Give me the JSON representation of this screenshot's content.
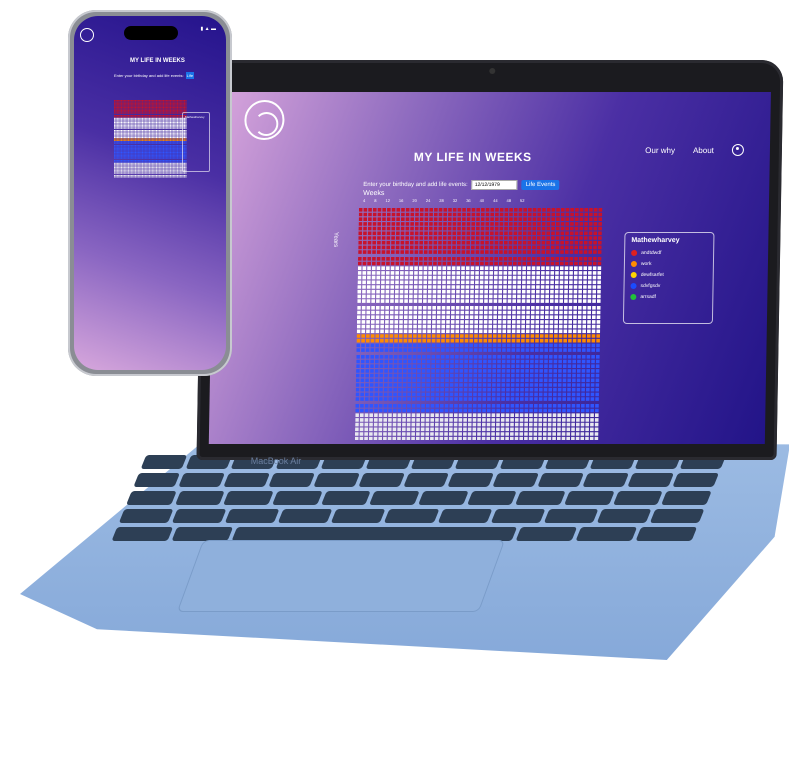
{
  "site": {
    "title": "MY LIFE IN WEEKS",
    "nav": [
      "Our why",
      "About"
    ],
    "birthday_prompt": "Enter your birthday and add life events:",
    "birthday_value": "12/12/1979",
    "life_events_button": "Life Events",
    "weeks_label": "Weeks",
    "years_label": "Years",
    "week_ticks": [
      "4",
      "8",
      "12",
      "16",
      "20",
      "24",
      "28",
      "32",
      "36",
      "40",
      "44",
      "48",
      "52"
    ],
    "legend": {
      "title": "Mathewharvey",
      "items": [
        {
          "label": "andtdwdf",
          "color": "#e02020"
        },
        {
          "label": "work",
          "color": "#ff8c00"
        },
        {
          "label": "dewfsarfet",
          "color": "#ffd400"
        },
        {
          "label": "sdvfgsdv",
          "color": "#1a4bff"
        },
        {
          "label": "arrsadf",
          "color": "#22c03a"
        }
      ]
    }
  },
  "device": {
    "laptop_brand": "MacBook Air",
    "phone_title": "MY LIFE IN WEEKS",
    "phone_button": "Life"
  },
  "grid_colors": {
    "past": "#c8122a",
    "future": "#ffffff",
    "work": "#ff8c00",
    "blue": "#2f55ff",
    "light": "#e8e8f0"
  }
}
